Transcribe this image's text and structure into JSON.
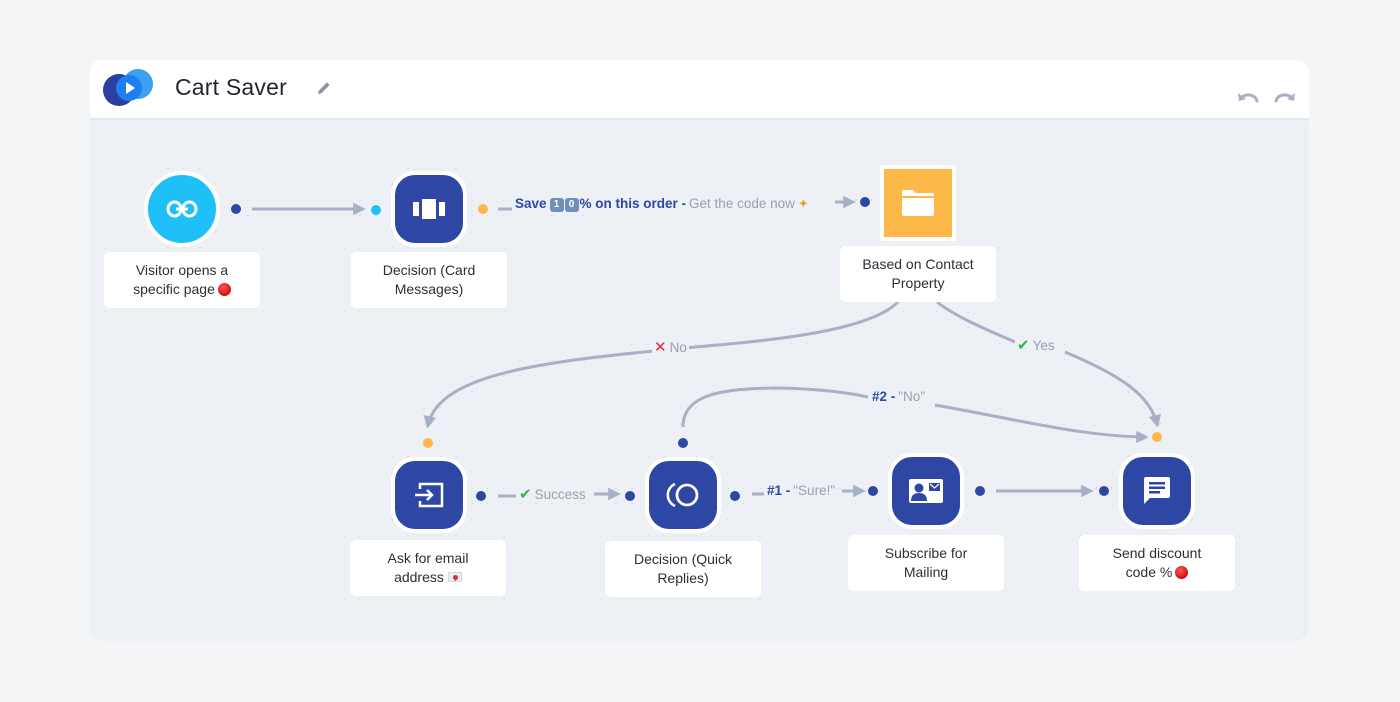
{
  "header": {
    "title": "Cart Saver",
    "logo_icon": "play-bubbles-logo",
    "edit_icon": "pencil-icon"
  },
  "toolbar": {
    "undo_icon": "undo-icon",
    "redo_icon": "redo-icon"
  },
  "colors": {
    "primary": "#2e47a5",
    "trigger": "#1ec0f7",
    "condition": "#fdb84a",
    "edge": "#a7b1c5",
    "success": "#2eb84a",
    "failure": "#e5283d"
  },
  "nodes": [
    {
      "id": "trigger",
      "label": "Visitor opens a specific page",
      "emoji": "red-circle",
      "icon": "link-icon",
      "shape": "circle"
    },
    {
      "id": "card-decision",
      "label_line1": "Decision (Card",
      "label_line2": "Messages)",
      "icon": "cards-icon",
      "shape": "rounded"
    },
    {
      "id": "contact-property",
      "label_line1": "Based on Contact",
      "label_line2": "Property",
      "icon": "folder-icon",
      "shape": "square"
    },
    {
      "id": "ask-email",
      "label_line1": "Ask for email",
      "label_line2": "address",
      "emoji": "love-letter",
      "icon": "input-icon",
      "shape": "rounded"
    },
    {
      "id": "quick-replies",
      "label_line1": "Decision (Quick",
      "label_line2": "Replies)",
      "icon": "quick-replies-icon",
      "shape": "rounded"
    },
    {
      "id": "subscribe",
      "label_line1": "Subscribe for",
      "label_line2": "Mailing",
      "icon": "contact-card-icon",
      "shape": "rounded"
    },
    {
      "id": "send-discount",
      "label_line1": "Send discount",
      "label_line2": "code %",
      "emoji": "red-circle",
      "icon": "chat-message-icon",
      "shape": "rounded"
    }
  ],
  "trigger_label_line1": "Visitor opens a",
  "trigger_label_line2": "specific page",
  "edges": {
    "card_to_property": {
      "strong": "Save",
      "key1": "1",
      "key2": "0",
      "strong_after": "% on this order -",
      "muted": "Get the code now"
    },
    "no_branch": {
      "icon": "cross-icon",
      "text": "No"
    },
    "yes_branch": {
      "icon": "check-icon",
      "text": "Yes"
    },
    "success": {
      "icon": "check-icon",
      "text": "Success"
    },
    "reply_1": {
      "strong": "#1 -",
      "muted": "\"Sure!\""
    },
    "reply_2": {
      "strong": "#2 -",
      "muted": "\"No\""
    }
  }
}
